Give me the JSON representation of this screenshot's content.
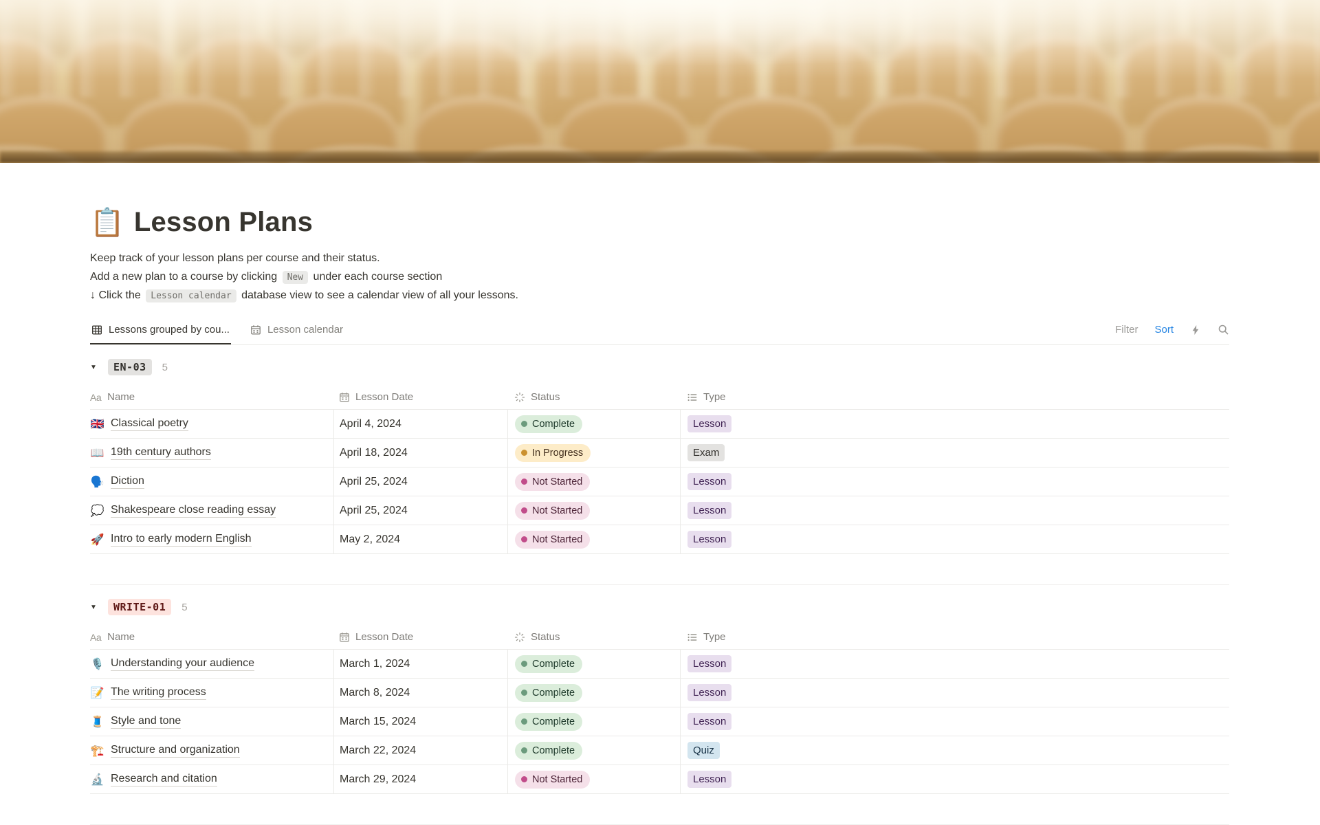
{
  "page": {
    "icon": "📋",
    "title": "Lesson Plans",
    "description": [
      [
        {
          "t": "Keep track of your lesson plans per course and their status."
        }
      ],
      [
        {
          "t": "Add a new plan to a course by clicking"
        },
        {
          "c": "New"
        },
        {
          "t": "under each course section"
        }
      ],
      [
        {
          "t": "↓ Click the"
        },
        {
          "c": "Lesson calendar"
        },
        {
          "t": "database view to see a calendar view of all your lessons."
        }
      ]
    ]
  },
  "toolbar": {
    "tabs": [
      {
        "label": "Lessons grouped by cou...",
        "icon": "table-icon",
        "active": true
      },
      {
        "label": "Lesson calendar",
        "icon": "calendar-icon",
        "active": false
      }
    ],
    "filter_label": "Filter",
    "sort_label": "Sort",
    "sort_color": "#2383E2"
  },
  "table": {
    "columns": [
      {
        "label": "Name",
        "icon": "aa-icon"
      },
      {
        "label": "Lesson Date",
        "icon": "calendar-icon"
      },
      {
        "label": "Status",
        "icon": "status-icon"
      },
      {
        "label": "Type",
        "icon": "list-icon"
      }
    ]
  },
  "status_styles": {
    "Complete": {
      "bg": "#DBEDDB",
      "dot": "#6C9B7D",
      "color": "#1C3829"
    },
    "In Progress": {
      "bg": "#FDECC8",
      "dot": "#CB912F",
      "color": "#402C1B"
    },
    "Not Started": {
      "bg": "#F5E0E9",
      "dot": "#C14C8A",
      "color": "#4C2337"
    }
  },
  "type_styles": {
    "Lesson": {
      "bg": "#E8DEEE",
      "color": "#412454"
    },
    "Exam": {
      "bg": "#E3E2E0",
      "color": "#32302C"
    },
    "Quiz": {
      "bg": "#D3E5EF",
      "color": "#183347"
    }
  },
  "groups": [
    {
      "name": "EN-03",
      "badge_bg": "#E3E2E0",
      "badge_color": "#32302C",
      "count": "5",
      "rows": [
        {
          "emoji": "🇬🇧",
          "name": "Classical poetry",
          "date": "April 4, 2024",
          "status": "Complete",
          "type": "Lesson"
        },
        {
          "emoji": "📖",
          "name": "19th century authors",
          "date": "April 18, 2024",
          "status": "In Progress",
          "type": "Exam"
        },
        {
          "emoji": "🗣️",
          "name": "Diction",
          "date": "April 25, 2024",
          "status": "Not Started",
          "type": "Lesson"
        },
        {
          "emoji": "💭",
          "name": "Shakespeare close reading essay",
          "date": "April 25, 2024",
          "status": "Not Started",
          "type": "Lesson"
        },
        {
          "emoji": "🚀",
          "name": "Intro to early modern English",
          "date": "May 2, 2024",
          "status": "Not Started",
          "type": "Lesson"
        }
      ]
    },
    {
      "name": "WRITE-01",
      "badge_bg": "#FDE3DE",
      "badge_color": "#5D1715",
      "count": "5",
      "rows": [
        {
          "emoji": "🎙️",
          "name": "Understanding your audience",
          "date": "March 1, 2024",
          "status": "Complete",
          "type": "Lesson"
        },
        {
          "emoji": "📝",
          "name": "The writing process",
          "date": "March 8, 2024",
          "status": "Complete",
          "type": "Lesson"
        },
        {
          "emoji": "🧵",
          "name": "Style and tone",
          "date": "March 15, 2024",
          "status": "Complete",
          "type": "Lesson"
        },
        {
          "emoji": "🏗️",
          "name": "Structure and organization",
          "date": "March 22, 2024",
          "status": "Complete",
          "type": "Quiz"
        },
        {
          "emoji": "🔬",
          "name": "Research and citation",
          "date": "March 29, 2024",
          "status": "Not Started",
          "type": "Lesson"
        }
      ]
    }
  ]
}
